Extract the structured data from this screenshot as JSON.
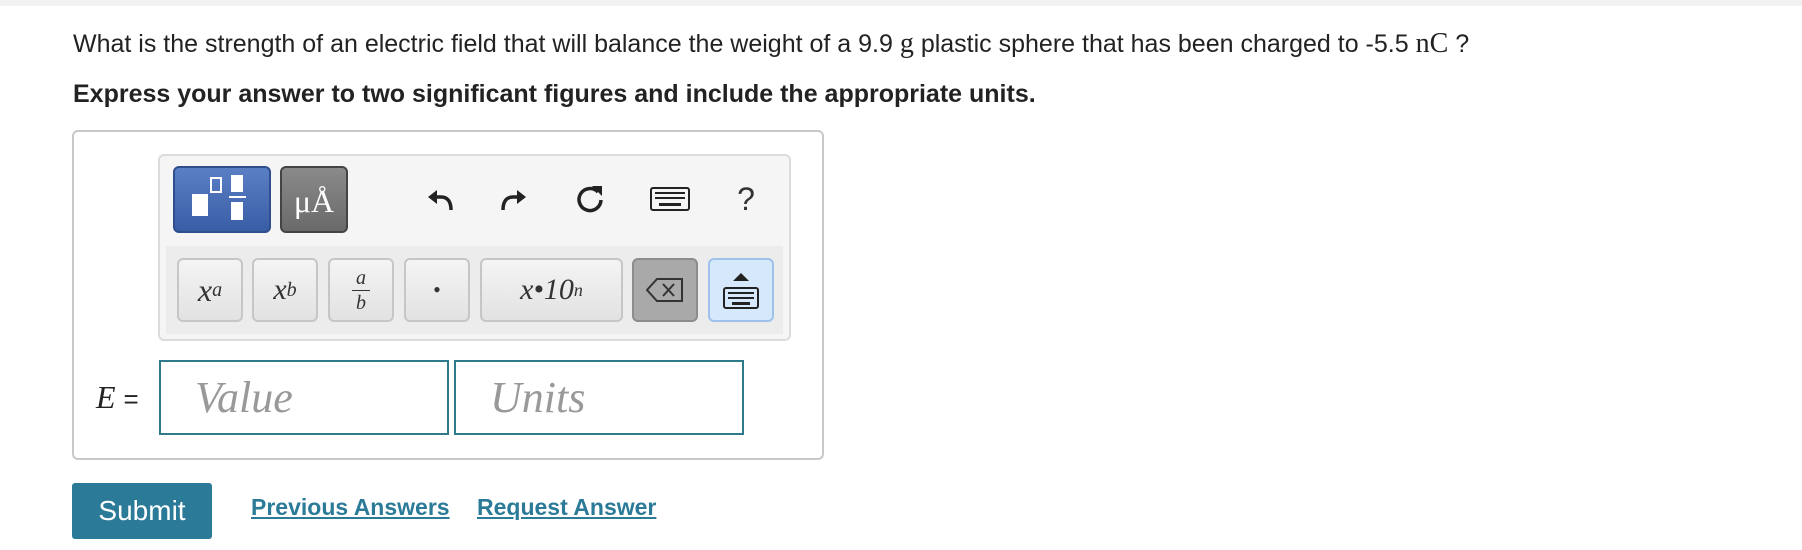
{
  "question": {
    "prefix": "What is the strength of an electric field that will balance the weight of a 9.9",
    "mass_unit": "g",
    "middle": "plastic sphere that has been charged to -5.5",
    "charge_unit": "nC",
    "suffix": "?"
  },
  "instruction": "Express your answer to two significant figures and include the appropriate units.",
  "toolbar": {
    "units_label": "μÅ",
    "help_label": "?",
    "icons": [
      "templates-icon",
      "units-icon",
      "undo-icon",
      "redo-icon",
      "reset-icon",
      "keyboard-icon",
      "help-icon"
    ],
    "keys": {
      "superscript": "x",
      "superscript_exp": "a",
      "subscript": "x",
      "subscript_sub": "b",
      "fraction_num": "a",
      "fraction_den": "b",
      "dot": "•",
      "sci_notation": "x•10",
      "sci_exp": "n"
    }
  },
  "answer": {
    "variable": "E",
    "equals": "=",
    "value_placeholder": "Value",
    "units_placeholder": "Units"
  },
  "actions": {
    "submit": "Submit",
    "previous_answers": "Previous Answers",
    "request_answer": "Request Answer"
  },
  "colors": {
    "accent": "#2a7a98",
    "template_button": "#3a5ea6",
    "field_border": "#2e7a8a"
  }
}
